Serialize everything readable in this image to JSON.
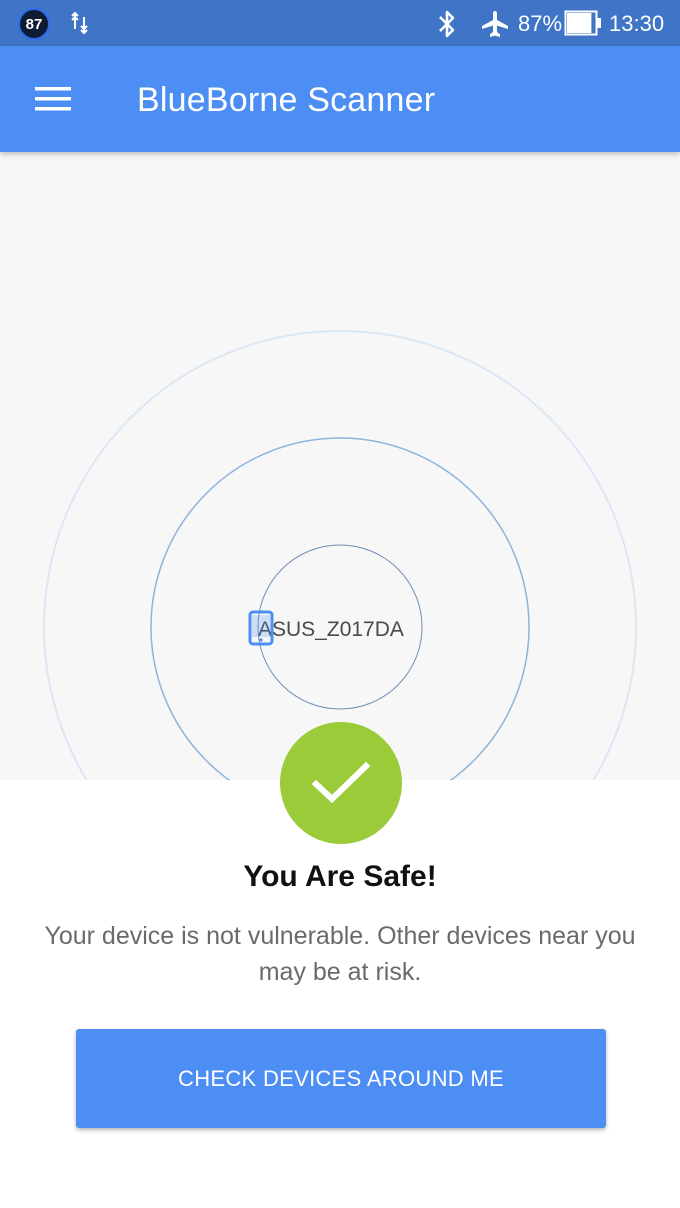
{
  "status_bar": {
    "badge": "87",
    "battery_percent": "87%",
    "time": "13:30",
    "icons": [
      "sync-icon",
      "bluetooth-icon",
      "airplane-icon",
      "battery-icon"
    ],
    "battery_level": 0.87
  },
  "app_bar": {
    "title": "BlueBorne Scanner",
    "menu_icon": "hamburger-menu-icon"
  },
  "radar": {
    "device_name": "ASUS_Z017DA",
    "device_icon": "phone-icon"
  },
  "result": {
    "icon": "checkmark-icon",
    "title": "You Are Safe!",
    "description": "Your device is not vulnerable. Other devices near you may be at risk."
  },
  "cta": {
    "label": "CHECK DEVICES AROUND ME"
  },
  "colors": {
    "status_bar": "#3f74c7",
    "primary": "#4c8ef3",
    "success": "#9ccb3a",
    "radar_background": "#f7f7f7"
  }
}
